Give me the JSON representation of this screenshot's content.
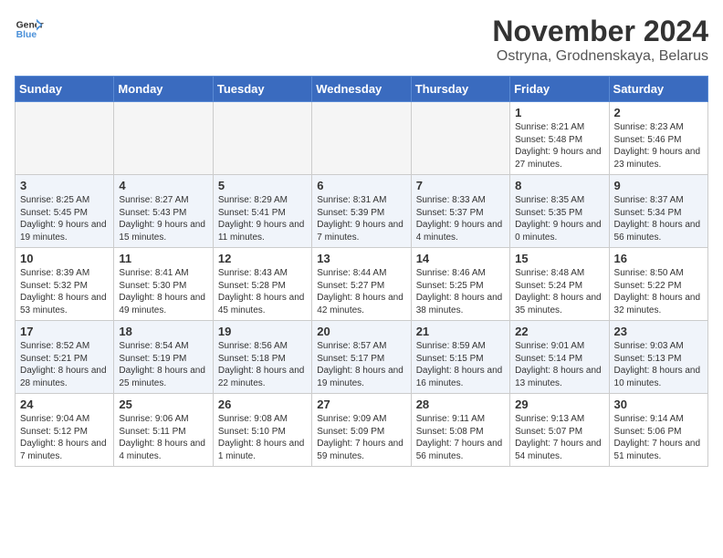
{
  "logo": {
    "line1": "General",
    "line2": "Blue"
  },
  "title": "November 2024",
  "location": "Ostryna, Grodnenskaya, Belarus",
  "weekdays": [
    "Sunday",
    "Monday",
    "Tuesday",
    "Wednesday",
    "Thursday",
    "Friday",
    "Saturday"
  ],
  "weeks": [
    [
      {
        "day": "",
        "info": ""
      },
      {
        "day": "",
        "info": ""
      },
      {
        "day": "",
        "info": ""
      },
      {
        "day": "",
        "info": ""
      },
      {
        "day": "",
        "info": ""
      },
      {
        "day": "1",
        "info": "Sunrise: 8:21 AM\nSunset: 5:48 PM\nDaylight: 9 hours\nand 27 minutes."
      },
      {
        "day": "2",
        "info": "Sunrise: 8:23 AM\nSunset: 5:46 PM\nDaylight: 9 hours\nand 23 minutes."
      }
    ],
    [
      {
        "day": "3",
        "info": "Sunrise: 8:25 AM\nSunset: 5:45 PM\nDaylight: 9 hours\nand 19 minutes."
      },
      {
        "day": "4",
        "info": "Sunrise: 8:27 AM\nSunset: 5:43 PM\nDaylight: 9 hours\nand 15 minutes."
      },
      {
        "day": "5",
        "info": "Sunrise: 8:29 AM\nSunset: 5:41 PM\nDaylight: 9 hours\nand 11 minutes."
      },
      {
        "day": "6",
        "info": "Sunrise: 8:31 AM\nSunset: 5:39 PM\nDaylight: 9 hours\nand 7 minutes."
      },
      {
        "day": "7",
        "info": "Sunrise: 8:33 AM\nSunset: 5:37 PM\nDaylight: 9 hours\nand 4 minutes."
      },
      {
        "day": "8",
        "info": "Sunrise: 8:35 AM\nSunset: 5:35 PM\nDaylight: 9 hours\nand 0 minutes."
      },
      {
        "day": "9",
        "info": "Sunrise: 8:37 AM\nSunset: 5:34 PM\nDaylight: 8 hours\nand 56 minutes."
      }
    ],
    [
      {
        "day": "10",
        "info": "Sunrise: 8:39 AM\nSunset: 5:32 PM\nDaylight: 8 hours\nand 53 minutes."
      },
      {
        "day": "11",
        "info": "Sunrise: 8:41 AM\nSunset: 5:30 PM\nDaylight: 8 hours\nand 49 minutes."
      },
      {
        "day": "12",
        "info": "Sunrise: 8:43 AM\nSunset: 5:28 PM\nDaylight: 8 hours\nand 45 minutes."
      },
      {
        "day": "13",
        "info": "Sunrise: 8:44 AM\nSunset: 5:27 PM\nDaylight: 8 hours\nand 42 minutes."
      },
      {
        "day": "14",
        "info": "Sunrise: 8:46 AM\nSunset: 5:25 PM\nDaylight: 8 hours\nand 38 minutes."
      },
      {
        "day": "15",
        "info": "Sunrise: 8:48 AM\nSunset: 5:24 PM\nDaylight: 8 hours\nand 35 minutes."
      },
      {
        "day": "16",
        "info": "Sunrise: 8:50 AM\nSunset: 5:22 PM\nDaylight: 8 hours\nand 32 minutes."
      }
    ],
    [
      {
        "day": "17",
        "info": "Sunrise: 8:52 AM\nSunset: 5:21 PM\nDaylight: 8 hours\nand 28 minutes."
      },
      {
        "day": "18",
        "info": "Sunrise: 8:54 AM\nSunset: 5:19 PM\nDaylight: 8 hours\nand 25 minutes."
      },
      {
        "day": "19",
        "info": "Sunrise: 8:56 AM\nSunset: 5:18 PM\nDaylight: 8 hours\nand 22 minutes."
      },
      {
        "day": "20",
        "info": "Sunrise: 8:57 AM\nSunset: 5:17 PM\nDaylight: 8 hours\nand 19 minutes."
      },
      {
        "day": "21",
        "info": "Sunrise: 8:59 AM\nSunset: 5:15 PM\nDaylight: 8 hours\nand 16 minutes."
      },
      {
        "day": "22",
        "info": "Sunrise: 9:01 AM\nSunset: 5:14 PM\nDaylight: 8 hours\nand 13 minutes."
      },
      {
        "day": "23",
        "info": "Sunrise: 9:03 AM\nSunset: 5:13 PM\nDaylight: 8 hours\nand 10 minutes."
      }
    ],
    [
      {
        "day": "24",
        "info": "Sunrise: 9:04 AM\nSunset: 5:12 PM\nDaylight: 8 hours\nand 7 minutes."
      },
      {
        "day": "25",
        "info": "Sunrise: 9:06 AM\nSunset: 5:11 PM\nDaylight: 8 hours\nand 4 minutes."
      },
      {
        "day": "26",
        "info": "Sunrise: 9:08 AM\nSunset: 5:10 PM\nDaylight: 8 hours\nand 1 minute."
      },
      {
        "day": "27",
        "info": "Sunrise: 9:09 AM\nSunset: 5:09 PM\nDaylight: 7 hours\nand 59 minutes."
      },
      {
        "day": "28",
        "info": "Sunrise: 9:11 AM\nSunset: 5:08 PM\nDaylight: 7 hours\nand 56 minutes."
      },
      {
        "day": "29",
        "info": "Sunrise: 9:13 AM\nSunset: 5:07 PM\nDaylight: 7 hours\nand 54 minutes."
      },
      {
        "day": "30",
        "info": "Sunrise: 9:14 AM\nSunset: 5:06 PM\nDaylight: 7 hours\nand 51 minutes."
      }
    ]
  ]
}
